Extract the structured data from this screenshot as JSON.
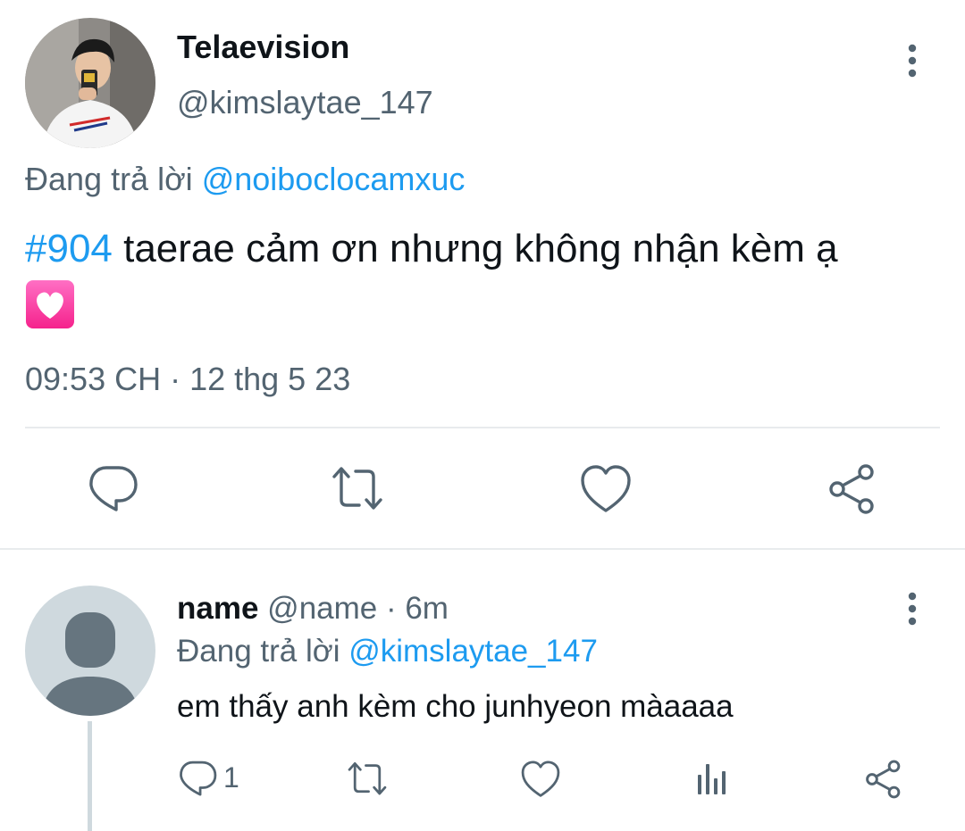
{
  "tweet": {
    "display_name": "Telaevision",
    "handle": "@kimslaytae_147",
    "replying_prefix": "Đang trả lời ",
    "replying_to": "@noiboclocamxuc",
    "hashtag": "#904",
    "text": " taerae cảm ơn nhưng không nhận kèm ạ",
    "emoji": "heart-decoration-icon",
    "timestamp": "09:53 CH · 12 thg 5 23",
    "actions": [
      "reply-icon",
      "retweet-icon",
      "like-icon",
      "share-icon"
    ]
  },
  "reply": {
    "name": "name",
    "meta": " @name · 6m",
    "replying_prefix": "Đang trả lời ",
    "replying_to": "@kimslaytae_147",
    "text": "em thấy anh kèm cho junhyeon màaaaa",
    "reply_count": "1",
    "actions": [
      "reply-icon",
      "retweet-icon",
      "like-icon",
      "analytics-icon",
      "share-icon"
    ]
  },
  "colors": {
    "link": "#1d9bf0",
    "muted": "#536471",
    "text": "#0f1419",
    "divider": "#e8ebed",
    "avatar_placeholder": "#cfd9de",
    "avatar_silhouette": "#66757f",
    "heart_emoji": "#ff3fa4"
  }
}
